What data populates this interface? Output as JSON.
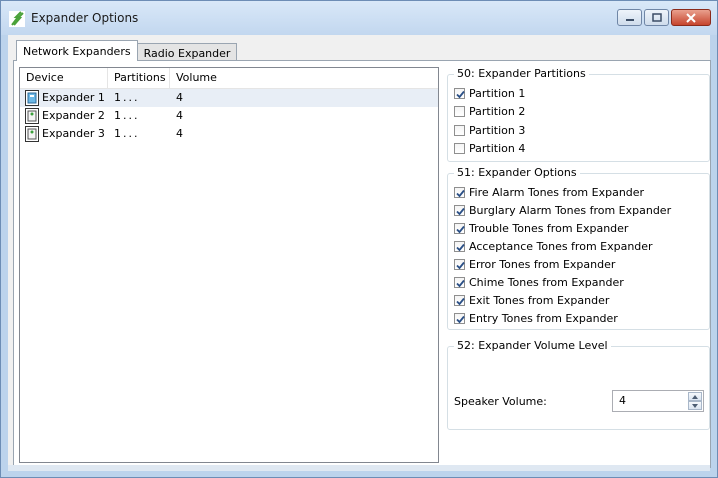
{
  "window": {
    "title": "Expander Options",
    "icon": "app-logo-icon",
    "caption_buttons": [
      "minimize-icon",
      "maximize-icon",
      "close-icon"
    ]
  },
  "tabs": [
    {
      "label": "Network Expanders",
      "active": true
    },
    {
      "label": "Radio Expander",
      "active": false
    }
  ],
  "device_list": {
    "columns": [
      "Device",
      "Partitions",
      "Volume"
    ],
    "rows": [
      {
        "device": "Expander 1",
        "partitions": "1...",
        "volume": "4",
        "selected": true
      },
      {
        "device": "Expander 2",
        "partitions": "1...",
        "volume": "4",
        "selected": false
      },
      {
        "device": "Expander 3",
        "partitions": "1...",
        "volume": "4",
        "selected": false
      }
    ]
  },
  "partitions_group": {
    "title": "50: Expander Partitions",
    "items": [
      {
        "label": "Partition 1",
        "checked": true
      },
      {
        "label": "Partition 2",
        "checked": false
      },
      {
        "label": "Partition 3",
        "checked": false
      },
      {
        "label": "Partition 4",
        "checked": false
      }
    ]
  },
  "options_group": {
    "title": "51: Expander Options",
    "items": [
      {
        "label": "Fire Alarm Tones from Expander",
        "checked": true
      },
      {
        "label": "Burglary Alarm Tones from Expander",
        "checked": true
      },
      {
        "label": "Trouble Tones from Expander",
        "checked": true
      },
      {
        "label": "Acceptance Tones from Expander",
        "checked": true
      },
      {
        "label": "Error Tones from Expander",
        "checked": true
      },
      {
        "label": "Chime Tones from Expander",
        "checked": true
      },
      {
        "label": "Exit Tones from Expander",
        "checked": true
      },
      {
        "label": "Entry Tones from Expander",
        "checked": true
      }
    ]
  },
  "volume_group": {
    "title": "52: Expander Volume Level",
    "speaker_label": "Speaker Volume:",
    "speaker_value": "4"
  },
  "colors": {
    "title_bar": "#c2d7ef",
    "close_button": "#c6452d",
    "selected_row": "#e8eef6",
    "checkmark": "#2a4f86"
  }
}
